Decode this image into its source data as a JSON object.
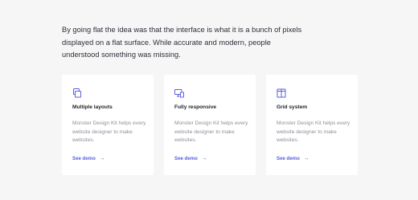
{
  "intro": {
    "text": "By going flat the idea was that the interface is what it is a bunch of pixels displayed on a flat surface. While accurate and modern, people understood something was missing."
  },
  "cards": [
    {
      "icon": "layers-icon",
      "title": "Multiple layouts",
      "description": "Monster Design Kit helps every website designer to make websites.",
      "link_label": "See demo"
    },
    {
      "icon": "responsive-devices-icon",
      "title": "Fully responsive",
      "description": "Monster Design Kit helps every website designer to make websites.",
      "link_label": "See demo"
    },
    {
      "icon": "grid-layout-icon",
      "title": "Grid system",
      "description": "Monster Design Kit helps every website designer to make websites.",
      "link_label": "See demo"
    }
  ],
  "colors": {
    "accent": "#5a5fdc",
    "background": "#f6f6f7",
    "card": "#ffffff",
    "text": "#2d2f36",
    "muted": "#8d909a"
  }
}
